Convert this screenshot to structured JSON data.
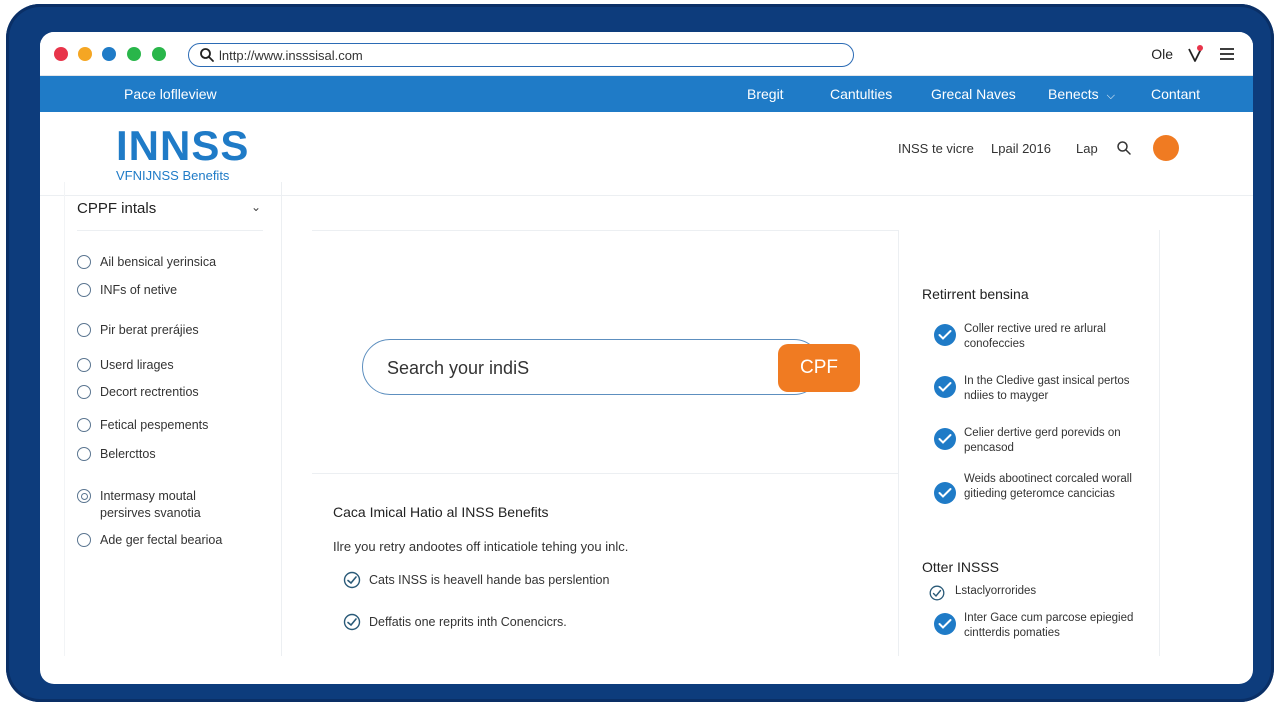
{
  "browser": {
    "url": "lnttp://www.insssisal.com",
    "account_label": "Ole",
    "traffic_colors": [
      "#e8344a",
      "#f5a623",
      "#1f7bc7",
      "#29b64a",
      "#29b64a"
    ]
  },
  "nav": {
    "brand": "Pace loflleview",
    "items": [
      {
        "label": "Bregit"
      },
      {
        "label": "Cantulties"
      },
      {
        "label": "Grecal Naves"
      },
      {
        "label": "Benects"
      },
      {
        "label": "Contant"
      }
    ]
  },
  "header": {
    "logo": "INNSS",
    "logo_sub": "VFNIJNSS Benefits",
    "links": [
      "INSS te vicre",
      "Lpail 2016",
      "Lap"
    ]
  },
  "sidebar": {
    "heading": "CPPF intals",
    "items": [
      {
        "label": "Ail bensical yerinsica"
      },
      {
        "label": "INFs of netive"
      },
      {
        "label": "Pir berat prerájies"
      },
      {
        "label": "Userd lirages"
      },
      {
        "label": "Decort rectrentios"
      },
      {
        "label": "Fetical pespements"
      },
      {
        "label": "Belercttos"
      },
      {
        "label": "Intermasy moutal persirves svanotia"
      },
      {
        "label": "Ade ger fectal bearioa"
      }
    ]
  },
  "search": {
    "placeholder": "Search your indiS",
    "button_label": "CPF"
  },
  "main": {
    "title": "Caca Imical Hatio al INSS Benefits",
    "description": "Ilre you retry andootes off inticatiole tehing you inlc.",
    "checks": [
      {
        "label": "Cats INSS is heavell hande bas perslention"
      },
      {
        "label": "Deffatis one reprits inth Conencicrs."
      }
    ]
  },
  "right_panel": {
    "title": "Retirrent bensina",
    "items": [
      {
        "label": "Coller rective ured re arlural conofeccies"
      },
      {
        "label": "In the Cledive gast insical pertos ndiies to mayger"
      },
      {
        "label": "Celier dertive gerd porevids on pencasod"
      },
      {
        "label": "Weids abootinect corcaled worall gitieding geteromce cancicias"
      }
    ],
    "other_title": "Otter INSSS",
    "other_items": [
      {
        "label": "Lstaclyorrorides"
      },
      {
        "label": "Inter Gace cum parcose epiegied cintterdis pomaties"
      }
    ]
  },
  "colors": {
    "brand_blue": "#1f7bc7",
    "accent_orange": "#f07b22",
    "frame_navy": "#0d3c7c"
  }
}
